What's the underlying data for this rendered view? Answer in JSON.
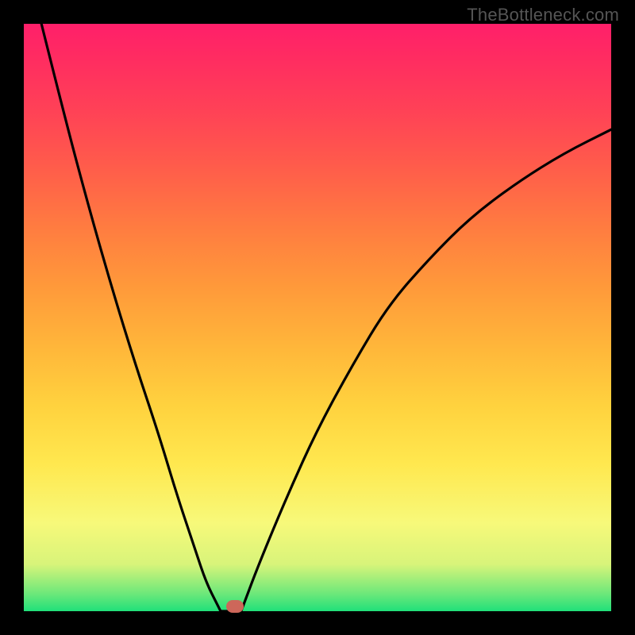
{
  "watermark": "TheBottleneck.com",
  "colors": {
    "page_bg": "#000000",
    "curve_stroke": "#000000",
    "marker_fill": "#cd675a"
  },
  "chart_data": {
    "type": "line",
    "title": "",
    "xlabel": "",
    "ylabel": "",
    "xlim": [
      0,
      100
    ],
    "ylim": [
      0,
      100
    ],
    "grid": false,
    "series": [
      {
        "name": "curve-left",
        "x": [
          3,
          7,
          11,
          15,
          19,
          23,
          26,
          29,
          31,
          33,
          33.5
        ],
        "values": [
          100,
          84,
          69,
          55,
          42,
          30,
          20,
          11,
          5,
          1,
          0
        ]
      },
      {
        "name": "curve-flat",
        "x": [
          33.5,
          37
        ],
        "values": [
          0,
          0
        ]
      },
      {
        "name": "curve-right",
        "x": [
          37,
          40,
          45,
          50,
          56,
          62,
          69,
          76,
          84,
          92,
          100
        ],
        "values": [
          0,
          8,
          20,
          31,
          42,
          52,
          60,
          67,
          73,
          78,
          82
        ]
      }
    ],
    "marker": {
      "x": 36,
      "y": 0.8
    }
  }
}
